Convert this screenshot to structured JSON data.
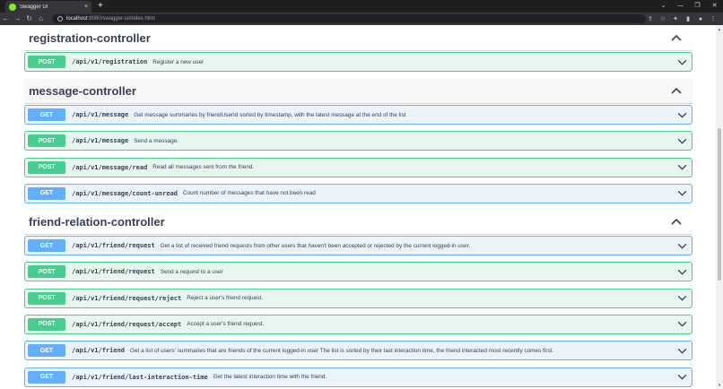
{
  "browser": {
    "tab_title": "Swagger UI",
    "tab_close": "×",
    "new_tab": "+",
    "url_host": "localhost",
    "url_path": ":8080/swagger-ui/index.html",
    "icons": [
      "back-arrow-icon",
      "forward-arrow-icon",
      "reload-icon",
      "home-icon",
      "share-icon",
      "bookmark-star-icon",
      "extensions-icon",
      "sidebar-icon",
      "profile-icon",
      "menu-icon"
    ]
  },
  "colors": {
    "post": "#49cc90",
    "post_bg": "#e8f6f0",
    "get": "#61affe",
    "get_bg": "#ebf3fb",
    "text": "#3b4151"
  },
  "controllers": [
    {
      "name": "registration-controller",
      "ops": [
        {
          "method": "POST",
          "path": "/api/v1/registration",
          "summary": "Register a new user"
        }
      ]
    },
    {
      "name": "message-controller",
      "ops": [
        {
          "method": "GET",
          "path": "/api/v1/message",
          "summary": "Get message summaries by friendUserId sorted by timestamp, with the latest message at the end of the list"
        },
        {
          "method": "POST",
          "path": "/api/v1/message",
          "summary": "Send a message."
        },
        {
          "method": "POST",
          "path": "/api/v1/message/read",
          "summary": "Read all messages sent from the friend."
        },
        {
          "method": "GET",
          "path": "/api/v1/message/count-unread",
          "summary": "Count number of messages that have not been read"
        }
      ]
    },
    {
      "name": "friend-relation-controller",
      "ops": [
        {
          "method": "GET",
          "path": "/api/v1/friend/request",
          "summary": "Get a list of received friend requests from other users that haven't been accepted or rejected by the current logged-in user."
        },
        {
          "method": "POST",
          "path": "/api/v1/friend/request",
          "summary": "Send a request to a user"
        },
        {
          "method": "POST",
          "path": "/api/v1/friend/request/reject",
          "summary": "Reject a user's friend request."
        },
        {
          "method": "POST",
          "path": "/api/v1/friend/request/accept",
          "summary": "Accept a user's friend request."
        },
        {
          "method": "GET",
          "path": "/api/v1/friend",
          "summary": "Get a list of users' summaries that are friends of the current logged-in user The list is sorted by their last interaction time, the friend interacted most recently comes first."
        },
        {
          "method": "GET",
          "path": "/api/v1/friend/last-interaction-time",
          "summary": "Get the latest interaction time with the friend."
        }
      ]
    }
  ]
}
